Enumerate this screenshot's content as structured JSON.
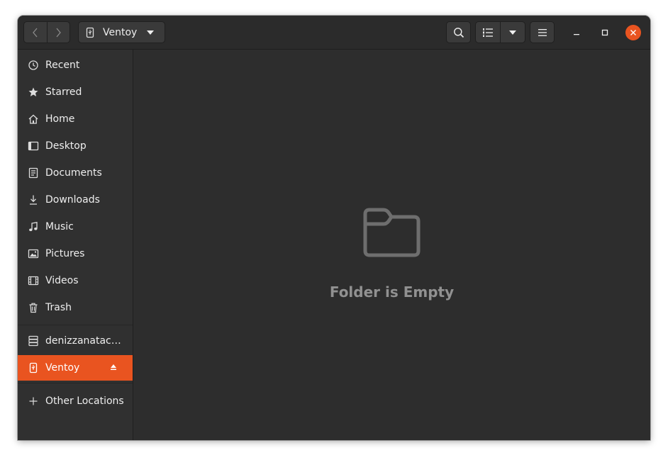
{
  "window": {
    "path_label": "Ventoy"
  },
  "sidebar": {
    "items": [
      {
        "label": "Recent",
        "icon": "clock-icon"
      },
      {
        "label": "Starred",
        "icon": "star-icon"
      },
      {
        "label": "Home",
        "icon": "home-icon"
      },
      {
        "label": "Desktop",
        "icon": "desktop-icon"
      },
      {
        "label": "Documents",
        "icon": "document-icon"
      },
      {
        "label": "Downloads",
        "icon": "download-icon"
      },
      {
        "label": "Music",
        "icon": "music-icon"
      },
      {
        "label": "Pictures",
        "icon": "picture-icon"
      },
      {
        "label": "Videos",
        "icon": "video-icon"
      },
      {
        "label": "Trash",
        "icon": "trash-icon"
      }
    ],
    "devices": [
      {
        "label": "denizzanatac…",
        "icon": "drive-icon"
      },
      {
        "label": "Ventoy",
        "icon": "usb-icon",
        "active": true
      }
    ],
    "other": {
      "label": "Other Locations",
      "icon": "plus-icon"
    }
  },
  "main": {
    "empty_message": "Folder is Empty"
  },
  "colors": {
    "accent": "#e95420",
    "window_bg": "#2d2d2d",
    "sidebar_bg": "#303030",
    "headerbar_bg": "#2b2b2b"
  }
}
